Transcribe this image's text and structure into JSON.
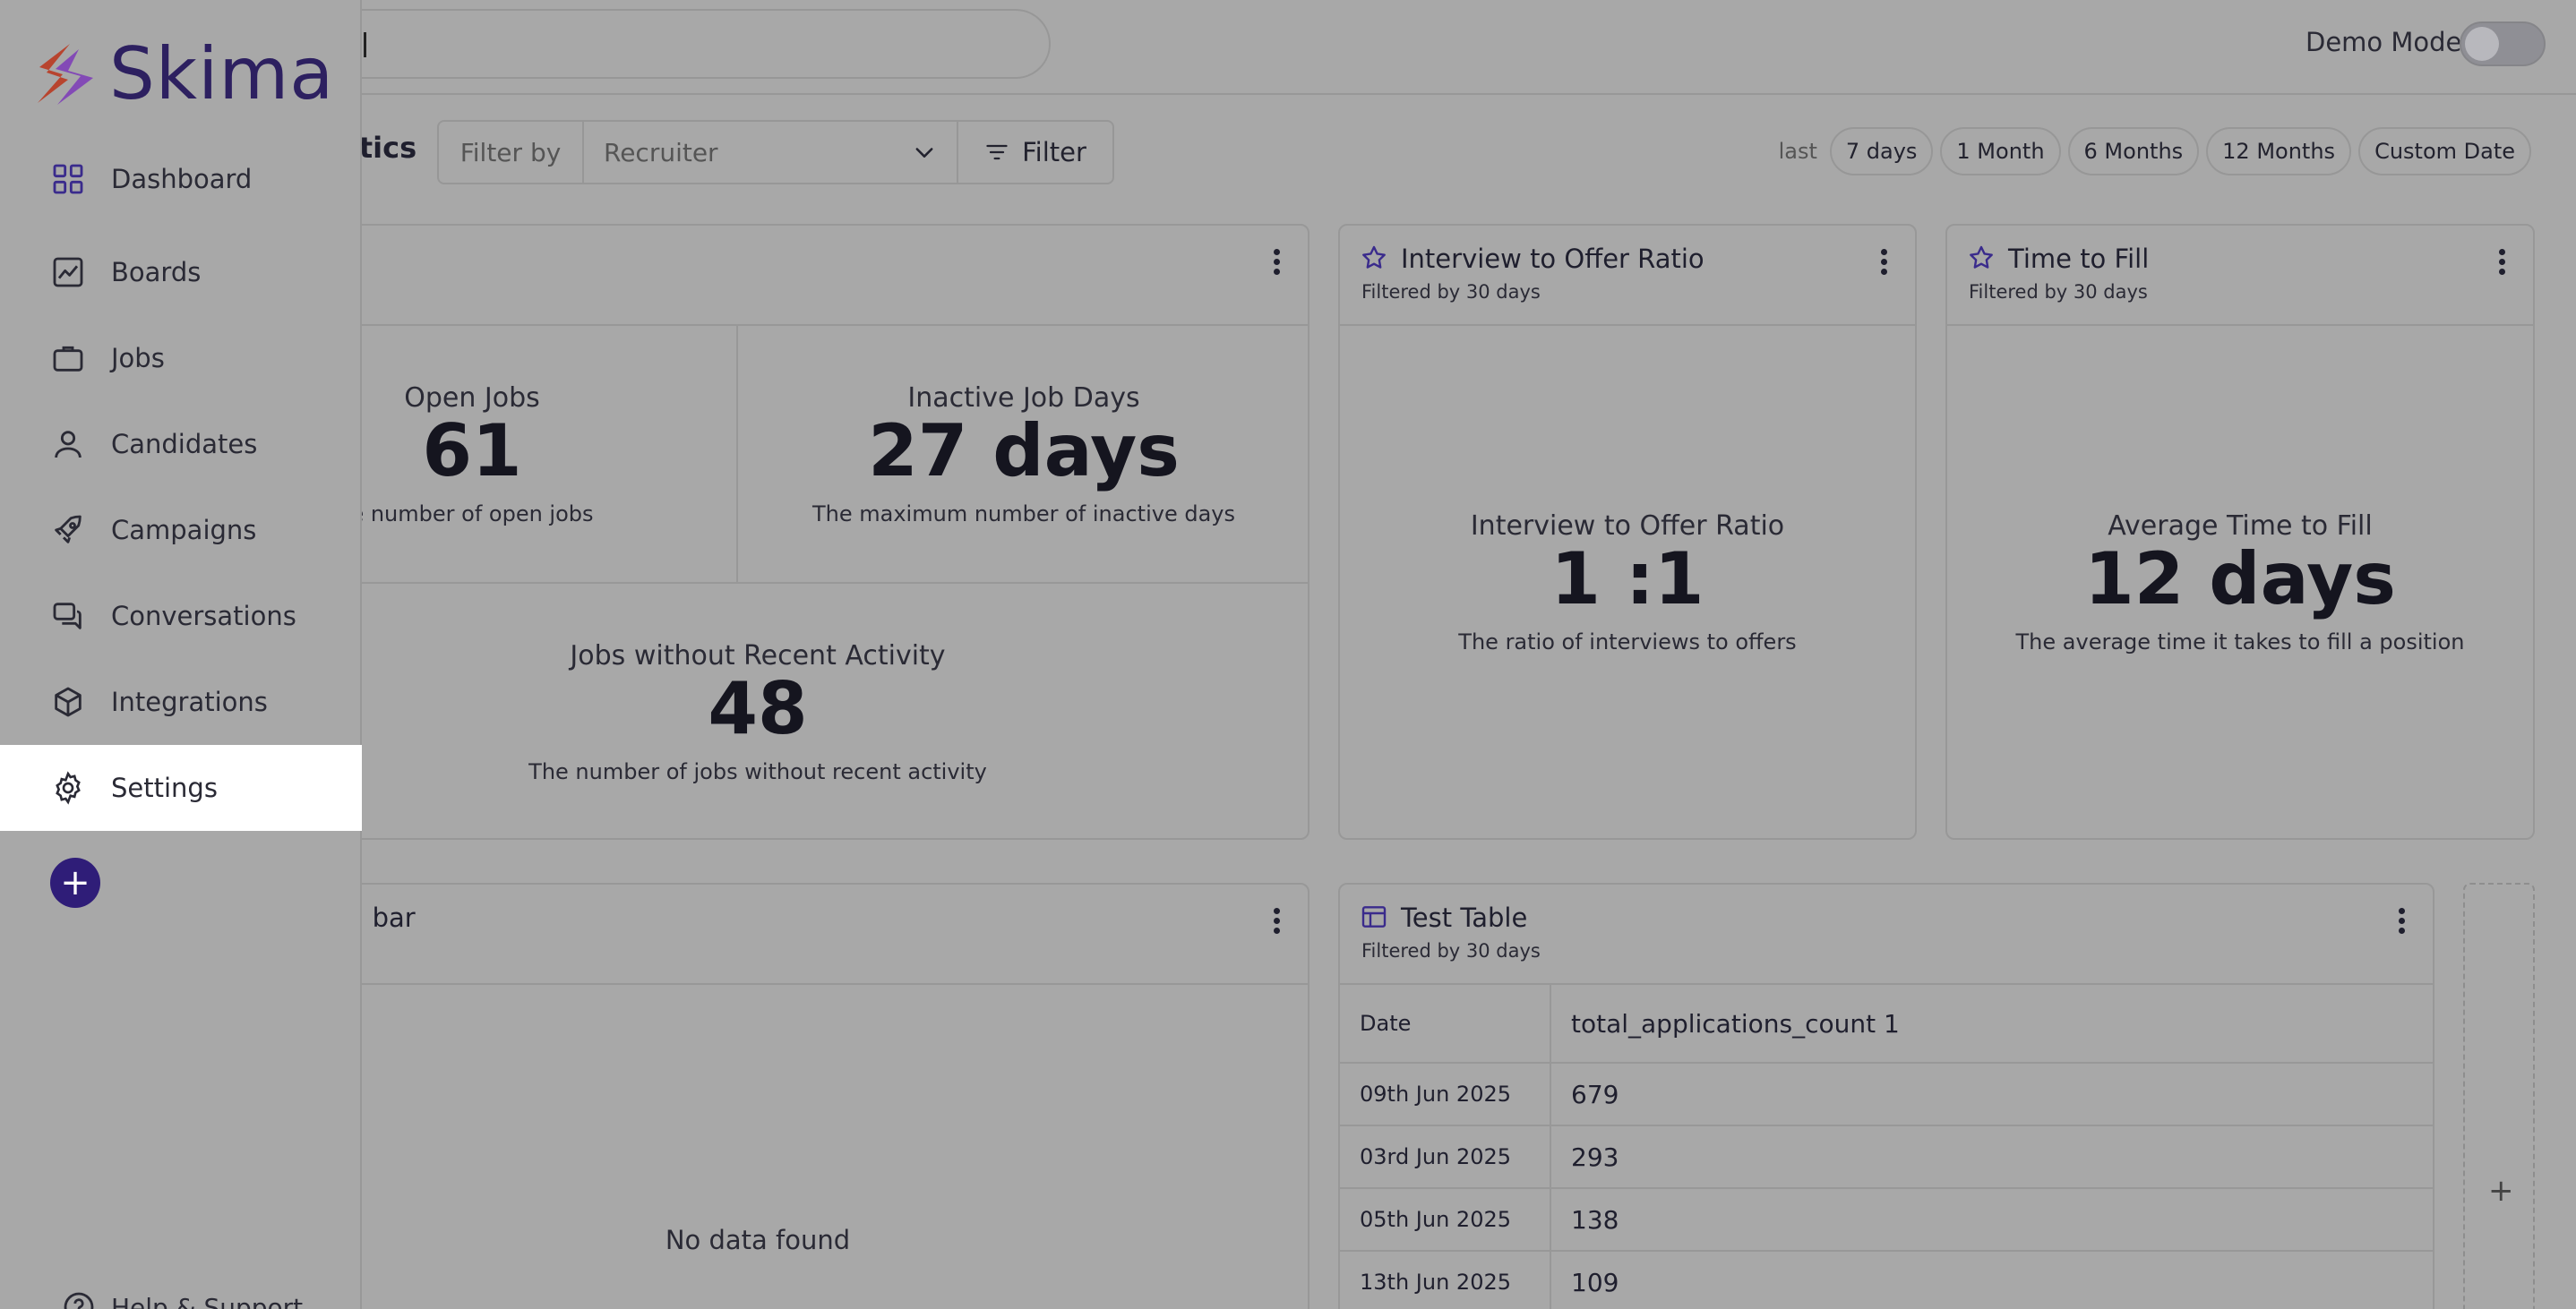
{
  "brand": {
    "name": "Skima"
  },
  "topbar": {
    "demo_mode_label": "Demo Mode",
    "demo_mode_on": false
  },
  "page": {
    "title_partial": "ytics"
  },
  "filters": {
    "filter_by_label": "Filter by",
    "recruiter_placeholder": "Recruiter",
    "filter_button": "Filter"
  },
  "range": {
    "label": "last",
    "options": [
      "7 days",
      "1 Month",
      "6 Months",
      "12 Months",
      "Custom Date"
    ]
  },
  "sidebar": {
    "items": [
      {
        "label": "Dashboard",
        "icon": "grid-icon"
      },
      {
        "label": "Boards",
        "icon": "chart-icon"
      },
      {
        "label": "Jobs",
        "icon": "briefcase-icon"
      },
      {
        "label": "Candidates",
        "icon": "user-icon"
      },
      {
        "label": "Campaigns",
        "icon": "rocket-icon"
      },
      {
        "label": "Conversations",
        "icon": "chat-icon"
      },
      {
        "label": "Integrations",
        "icon": "cube-icon"
      },
      {
        "label": "Settings",
        "icon": "gear-icon"
      }
    ],
    "active": "Settings",
    "help_label": "Help & Support"
  },
  "jobs_card": {
    "open_jobs": {
      "label": "Open Jobs",
      "value": "61",
      "desc": "e number of open jobs"
    },
    "inactive_days": {
      "label": "Inactive Job Days",
      "value": "27 days",
      "desc": "The maximum number of inactive days"
    },
    "no_activity": {
      "label": "Jobs without Recent Activity",
      "value": "48",
      "desc": "The number of jobs without recent activity"
    }
  },
  "interview_card": {
    "title": "Interview to Offer Ratio",
    "subtitle": "Filtered by 30 days",
    "label": "Interview to Offer Ratio",
    "value": "1 :1",
    "desc": "The ratio of interviews to offers"
  },
  "fill_card": {
    "title": "Time to Fill",
    "subtitle": "Filtered by 30 days",
    "label": "Average Time to Fill",
    "value": "12 days",
    "desc": "The average time it takes to fill a position"
  },
  "bar_card": {
    "title_partial": "d bar",
    "empty": "No data found"
  },
  "table_card": {
    "title": "Test Table",
    "subtitle": "Filtered by 30 days",
    "columns": [
      "Date",
      "total_applications_count 1"
    ],
    "rows": [
      [
        "09th Jun 2025",
        "679"
      ],
      [
        "03rd Jun 2025",
        "293"
      ],
      [
        "05th Jun 2025",
        "138"
      ],
      [
        "13th Jun 2025",
        "109"
      ]
    ]
  },
  "colors": {
    "brand_primary": "#2f1d78",
    "overlay": "#a8a8a8",
    "active_bg": "#ffffff"
  }
}
